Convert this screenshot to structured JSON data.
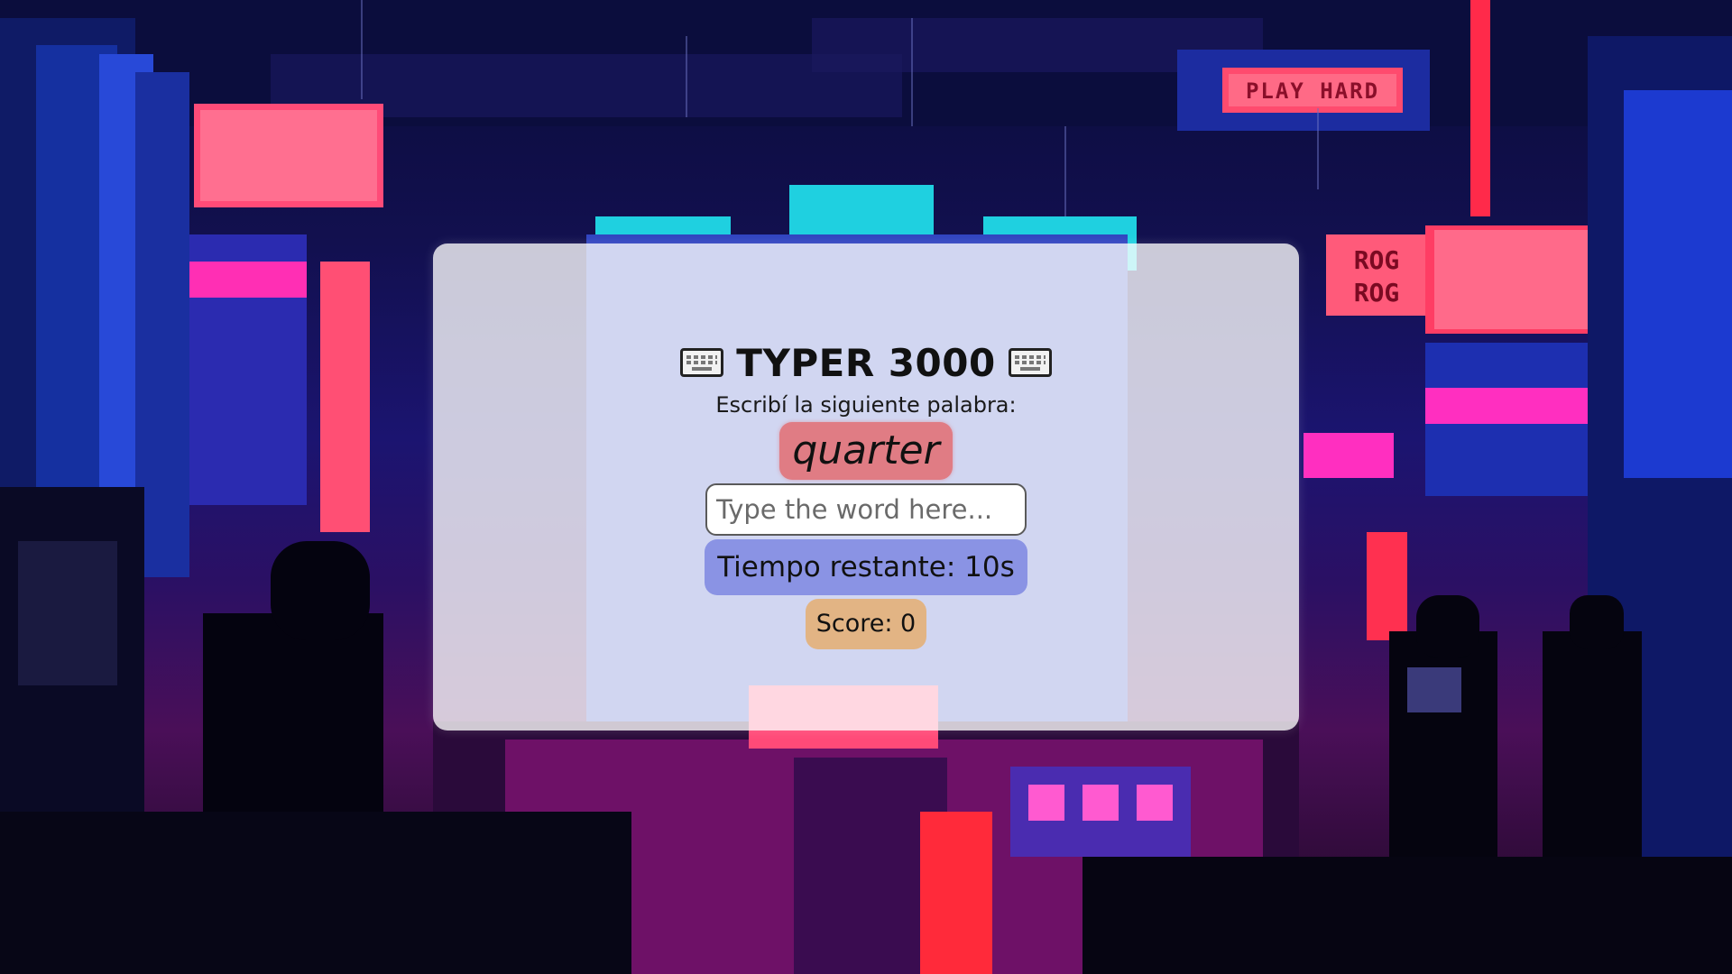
{
  "game": {
    "title": "TYPER 3000",
    "left_icon": "keyboard-icon",
    "right_icon": "keyboard-icon",
    "instruction": "Escribí la siguiente palabra:",
    "current_word": "quarter",
    "input": {
      "value": "",
      "placeholder": "Type the word here..."
    },
    "timer_text": "Tiempo restante: 10s",
    "score_text": "Score: 0"
  },
  "background": {
    "billboards": {
      "play_hard": "PLAY HARD",
      "rog_top": "ROG",
      "rog_bottom": "ROG"
    }
  },
  "colors": {
    "word_chip": "#e07c84",
    "timer_chip": "#8a93e4",
    "score_chip": "#e2b484",
    "card": "rgba(255,255,255,0.78)"
  }
}
